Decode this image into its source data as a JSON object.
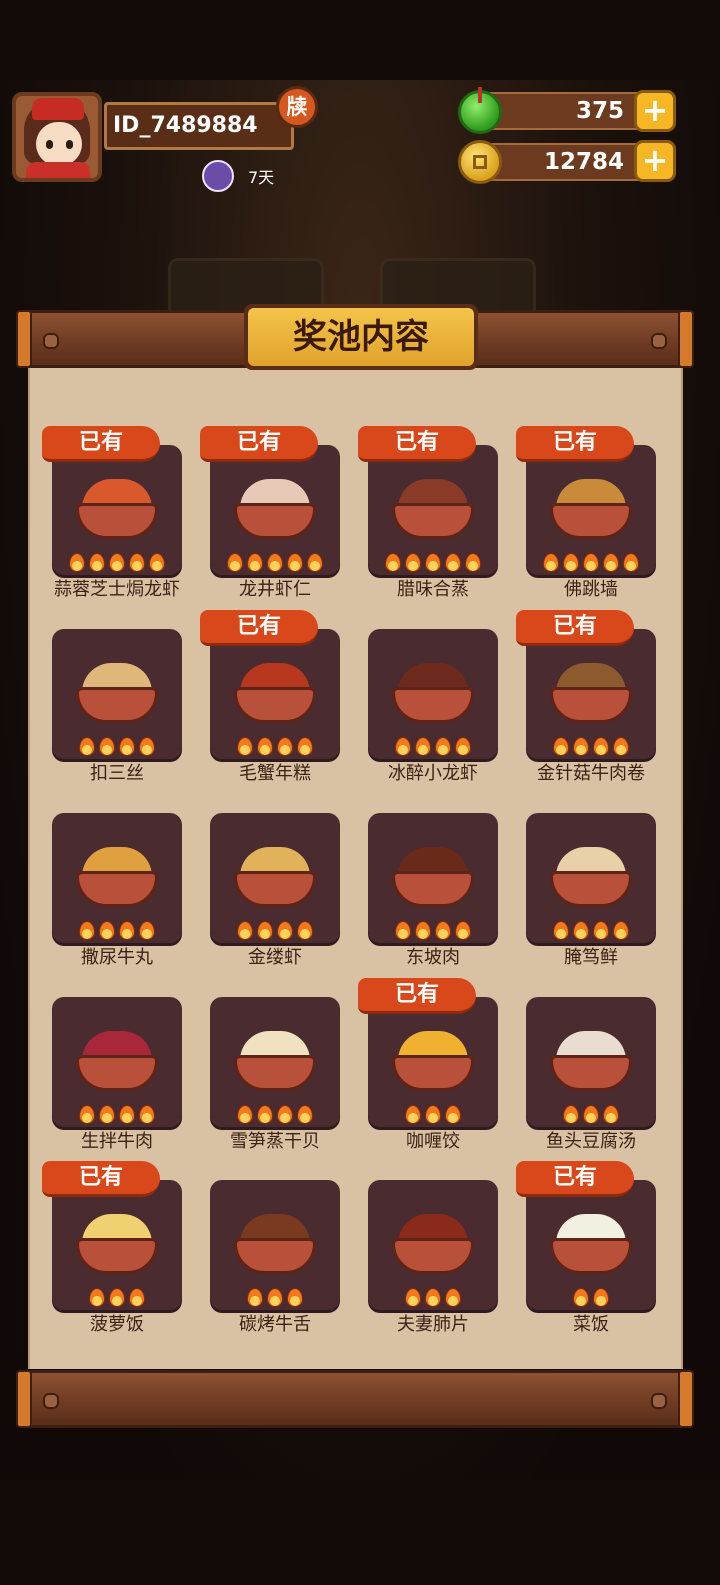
{
  "player": {
    "id": "ID_7489884",
    "badge": "牍",
    "days": "7天"
  },
  "resources": [
    {
      "name": "jade",
      "icon": "jade-icon",
      "value": "375"
    },
    {
      "name": "coins",
      "icon": "coin-icon",
      "value": "12784"
    }
  ],
  "panel": {
    "title": "奖池内容",
    "owned_label": "已有",
    "items": [
      {
        "name": "蒜蓉芝士焗龙虾",
        "owned": true,
        "flames": 5,
        "food_color": "#d9592d"
      },
      {
        "name": "龙井虾仁",
        "owned": true,
        "flames": 5,
        "food_color": "#e8c9b8"
      },
      {
        "name": "腊味合蒸",
        "owned": true,
        "flames": 5,
        "food_color": "#8a3b28"
      },
      {
        "name": "佛跳墙",
        "owned": true,
        "flames": 5,
        "food_color": "#c98a3a"
      },
      {
        "name": "扣三丝",
        "owned": false,
        "flames": 4,
        "food_color": "#e0b77a"
      },
      {
        "name": "毛蟹年糕",
        "owned": true,
        "flames": 4,
        "food_color": "#b8371f"
      },
      {
        "name": "冰醉小龙虾",
        "owned": false,
        "flames": 4,
        "food_color": "#6e2a1c"
      },
      {
        "name": "金针菇牛肉卷",
        "owned": true,
        "flames": 4,
        "food_color": "#8c5a2c"
      },
      {
        "name": "撒尿牛丸",
        "owned": false,
        "flames": 4,
        "food_color": "#e0a040"
      },
      {
        "name": "金缕虾",
        "owned": false,
        "flames": 4,
        "food_color": "#e2b25a"
      },
      {
        "name": "东坡肉",
        "owned": false,
        "flames": 4,
        "food_color": "#6a2a1a"
      },
      {
        "name": "腌笃鲜",
        "owned": false,
        "flames": 4,
        "food_color": "#e8d0a8"
      },
      {
        "name": "生拌牛肉",
        "owned": false,
        "flames": 4,
        "food_color": "#a8283a"
      },
      {
        "name": "雪笋蒸干贝",
        "owned": false,
        "flames": 4,
        "food_color": "#f0e2c0"
      },
      {
        "name": "咖喱饺",
        "owned": true,
        "flames": 3,
        "food_color": "#f0b030"
      },
      {
        "name": "鱼头豆腐汤",
        "owned": false,
        "flames": 3,
        "food_color": "#e8ddd0"
      },
      {
        "name": "菠萝饭",
        "owned": true,
        "flames": 3,
        "food_color": "#f0d070"
      },
      {
        "name": "碳烤牛舌",
        "owned": false,
        "flames": 3,
        "food_color": "#7a3a20"
      },
      {
        "name": "夫妻肺片",
        "owned": false,
        "flames": 3,
        "food_color": "#8a2a1a"
      },
      {
        "name": "菜饭",
        "owned": true,
        "flames": 2,
        "food_color": "#f2f0e0"
      }
    ]
  }
}
